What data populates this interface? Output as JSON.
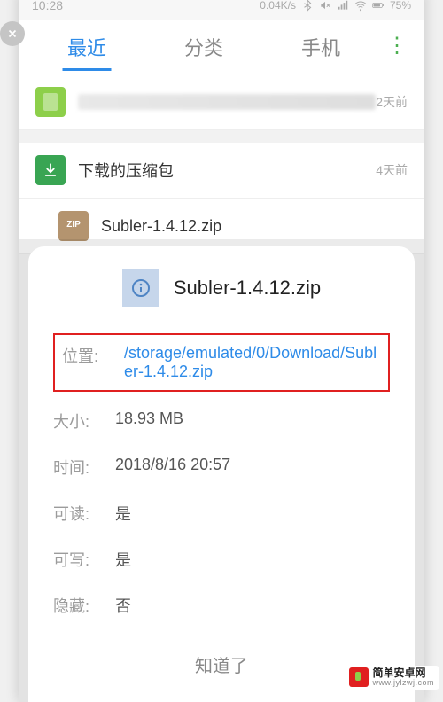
{
  "statusbar": {
    "time": "10:28",
    "speed": "0.04K/s",
    "battery": "75%"
  },
  "tabs": {
    "recent": "最近",
    "category": "分类",
    "phone": "手机"
  },
  "rows": {
    "blurred_time": "2天前",
    "folder_title": "下载的压缩包",
    "folder_time": "4天前",
    "zip_label": "ZIP",
    "zip_name": "Subler-1.4.12.zip"
  },
  "sheet": {
    "title": "Subler-1.4.12.zip",
    "location_label": "位置:",
    "location_value": "/storage/emulated/0/Download/Subler-1.4.12.zip",
    "size_label": "大小:",
    "size_value": "18.93 MB",
    "time_label": "时间:",
    "time_value": "2018/8/16 20:57",
    "readable_label": "可读:",
    "readable_value": "是",
    "writable_label": "可写:",
    "writable_value": "是",
    "hidden_label": "隐藏:",
    "hidden_value": "否",
    "ok": "知道了"
  },
  "watermark": {
    "line1": "简单安卓网",
    "line2": "www.jylzwj.com"
  }
}
